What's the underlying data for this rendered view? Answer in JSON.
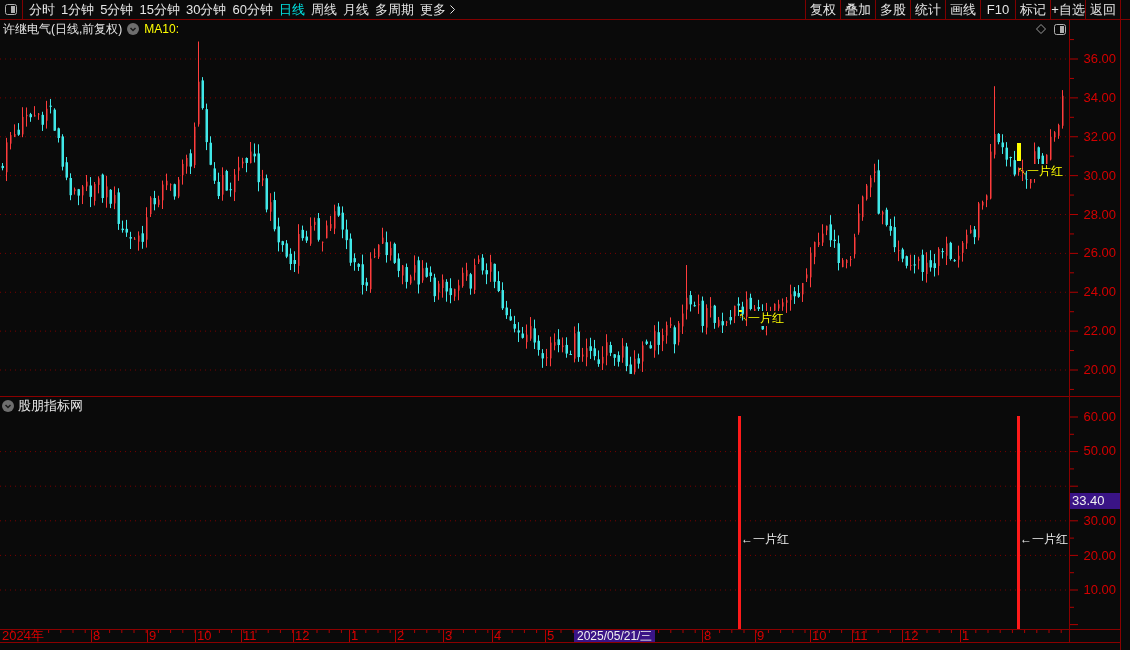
{
  "toolbar": {
    "periods": [
      {
        "label": "分时",
        "selected": false
      },
      {
        "label": "1分钟",
        "selected": false
      },
      {
        "label": "5分钟",
        "selected": false
      },
      {
        "label": "15分钟",
        "selected": false
      },
      {
        "label": "30分钟",
        "selected": false
      },
      {
        "label": "60分钟",
        "selected": false
      },
      {
        "label": "日线",
        "selected": true
      },
      {
        "label": "周线",
        "selected": false
      },
      {
        "label": "月线",
        "selected": false
      },
      {
        "label": "多周期",
        "selected": false
      }
    ],
    "more": "更多",
    "actions": [
      "复权",
      "叠加",
      "多股",
      "统计",
      "画线",
      "F10",
      "标记",
      "+自选",
      "返回"
    ]
  },
  "price_panel": {
    "title": "许继电气(日线,前复权)",
    "indicator": "MA10:",
    "axis_labels": [
      "36.00",
      "34.00",
      "32.00",
      "30.00",
      "28.00",
      "26.00",
      "24.00",
      "22.00",
      "20.00"
    ],
    "annotations": [
      {
        "label": "一片红"
      },
      {
        "label": "一片红"
      }
    ]
  },
  "indicator_panel": {
    "title": "股朋指标网",
    "axis_labels": [
      "60.00",
      "50.00",
      "30.00",
      "20.00",
      "10.00"
    ],
    "current_value": "33.40",
    "signals": [
      {
        "label": "←一片红"
      },
      {
        "label": "←一片红"
      }
    ]
  },
  "date_axis": {
    "labels": [
      "2024年",
      "8",
      "9",
      "10",
      "11",
      "12",
      "1",
      "2",
      "3",
      "4",
      "5",
      "8",
      "9",
      "10",
      "11",
      "12",
      "1"
    ],
    "cursor_date": "2025/05/21/三"
  }
}
